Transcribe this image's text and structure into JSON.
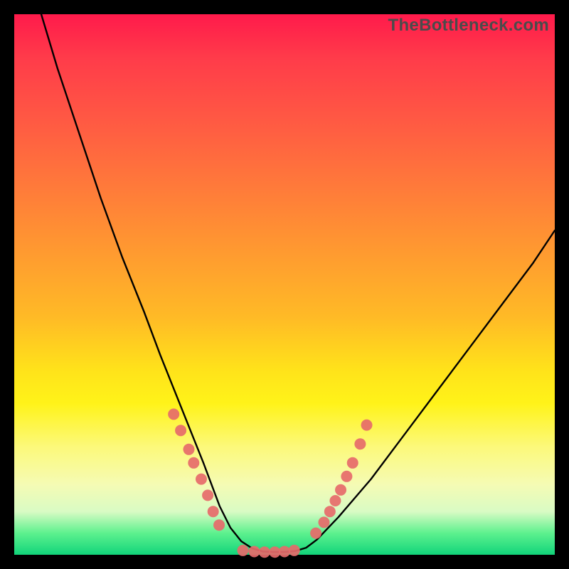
{
  "watermark": "TheBottleneck.com",
  "chart_data": {
    "type": "line",
    "title": "",
    "xlabel": "",
    "ylabel": "",
    "xlim": [
      0,
      100
    ],
    "ylim": [
      0,
      100
    ],
    "grid": false,
    "legend": false,
    "series": [
      {
        "name": "curve",
        "color": "#000000",
        "stroke_width": 2.4,
        "x": [
          5,
          8,
          12,
          16,
          20,
          24,
          27,
          29,
          31,
          33,
          35,
          36.5,
          38,
          40,
          42,
          44,
          46,
          48,
          50,
          52,
          54,
          56,
          60,
          66,
          72,
          78,
          84,
          90,
          96,
          100
        ],
        "y": [
          100,
          90,
          78,
          66,
          55,
          45,
          37,
          32,
          27,
          22,
          17,
          13,
          9,
          5,
          2.5,
          1.2,
          0.6,
          0.5,
          0.5,
          0.7,
          1.3,
          2.8,
          7,
          14,
          22,
          30,
          38,
          46,
          54,
          60
        ]
      },
      {
        "name": "markers-left",
        "color": "#e66a6a",
        "marker_only": true,
        "marker_radius": 8,
        "x": [
          29.5,
          30.8,
          32.3,
          33.2,
          34.6,
          35.8,
          36.8,
          37.9
        ],
        "y": [
          26.0,
          23.0,
          19.5,
          17.0,
          14.0,
          11.0,
          8.0,
          5.5
        ]
      },
      {
        "name": "markers-bottom",
        "color": "#e66a6a",
        "marker_only": true,
        "marker_radius": 8,
        "x": [
          42.3,
          44.4,
          46.3,
          48.2,
          50.0,
          51.8
        ],
        "y": [
          0.8,
          0.6,
          0.5,
          0.5,
          0.6,
          0.8
        ]
      },
      {
        "name": "markers-right",
        "color": "#e66a6a",
        "marker_only": true,
        "marker_radius": 8,
        "x": [
          55.8,
          57.3,
          58.4,
          59.4,
          60.4,
          61.5,
          62.6,
          64.0,
          65.2
        ],
        "y": [
          4.0,
          6.0,
          8.0,
          10.0,
          12.0,
          14.5,
          17.0,
          20.5,
          24.0
        ]
      }
    ],
    "gradient_stops": [
      {
        "pos": 0.0,
        "color": "#ff1a4b"
      },
      {
        "pos": 0.2,
        "color": "#ff5a43"
      },
      {
        "pos": 0.44,
        "color": "#ff9a30"
      },
      {
        "pos": 0.66,
        "color": "#ffe31a"
      },
      {
        "pos": 0.85,
        "color": "#f5fbb4"
      },
      {
        "pos": 1.0,
        "color": "#11d47a"
      }
    ]
  }
}
